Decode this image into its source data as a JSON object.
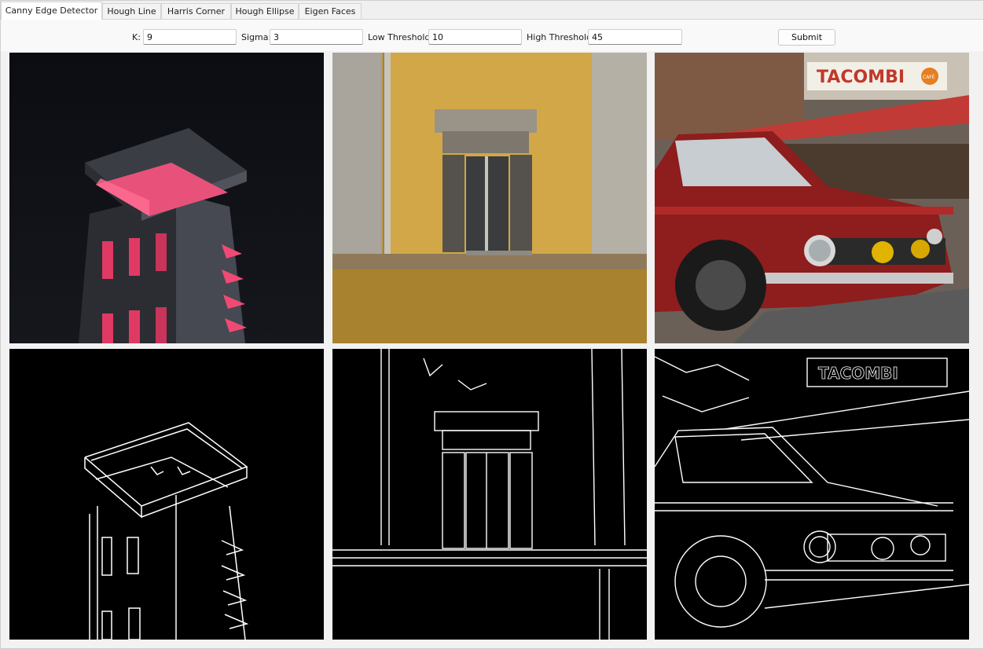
{
  "tabs": [
    "Canny Edge Detector",
    "Hough Line",
    "Harris Corner",
    "Hough Ellipse",
    "Eigen Faces"
  ],
  "active_tab": "Canny Edge Detector",
  "params": {
    "k_label": "K:",
    "k_value": "9",
    "sigma_label": "Sigma:",
    "sigma_value": "3",
    "low_label": "Low Threshold:",
    "low_value": "10",
    "high_label": "High Threshold:",
    "high_value": "45"
  },
  "submit_label": "Submit",
  "images": {
    "original": [
      "tower-photo",
      "yellow-window-photo",
      "red-car-photo"
    ],
    "edges": [
      "tower-edges",
      "window-edges",
      "car-edges"
    ]
  },
  "sign_text": "TACOMBI",
  "badge_text": "CAFÉ"
}
